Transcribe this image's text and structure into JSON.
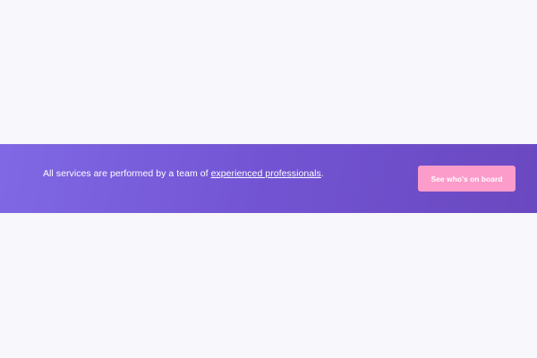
{
  "banner": {
    "text_before": "All services are performed by a team of ",
    "link_text": "experienced professionals",
    "text_after": ".",
    "cta_label": "See who's on board"
  },
  "colors": {
    "page_background": "#f7f7fc",
    "banner_gradient_start": "#8068e4",
    "banner_gradient_end": "#6a48c0",
    "cta_background": "#fc9ccb",
    "text": "#ffffff"
  }
}
